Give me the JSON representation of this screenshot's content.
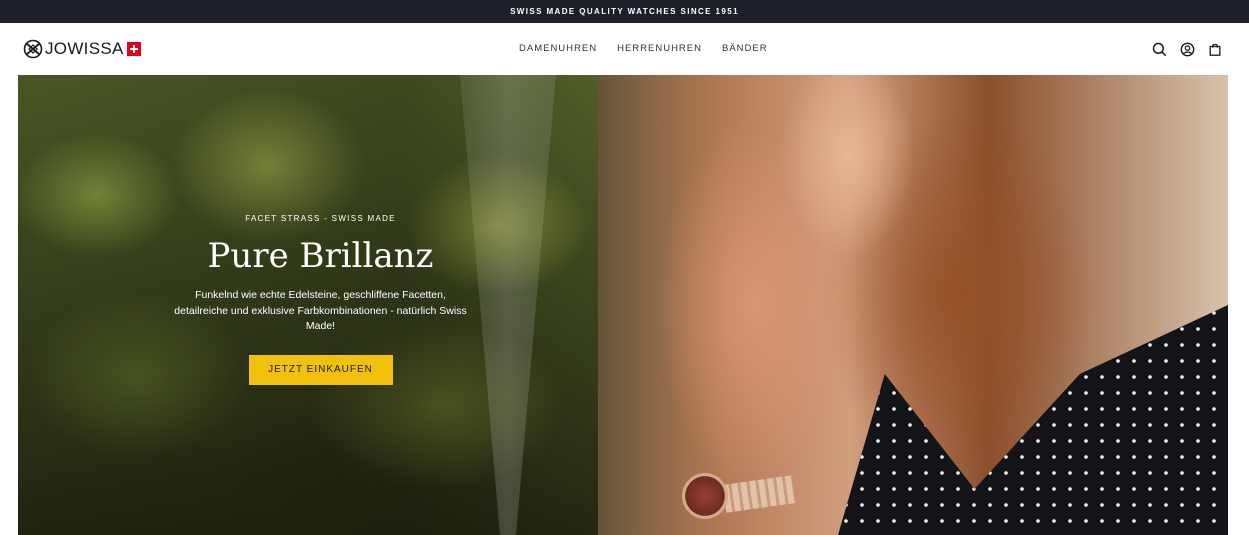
{
  "announcement": {
    "text": "SWISS MADE QUALITY WATCHES SINCE 1951"
  },
  "brand": {
    "name": "JOWISSA",
    "accent": "#e3001b"
  },
  "nav": {
    "items": [
      {
        "label": "DAMENUHREN"
      },
      {
        "label": "HERRENUHREN"
      },
      {
        "label": "BÄNDER"
      }
    ]
  },
  "header_icons": [
    "search-icon",
    "account-icon",
    "cart-icon"
  ],
  "hero": {
    "eyebrow": "FACET STRASS - SWISS MADE",
    "title": "Pure Brillanz",
    "description": "Funkelnd wie echte Edelsteine, geschliffene Facetten, detailreiche und exklusive Farbkombinationen - natürlich Swiss Made!",
    "cta_label": "JETZT EINKAUFEN",
    "cta_color": "#f2c10d"
  },
  "colors": {
    "announcement_bg": "#1d1f29",
    "header_bg": "#ffffff"
  }
}
